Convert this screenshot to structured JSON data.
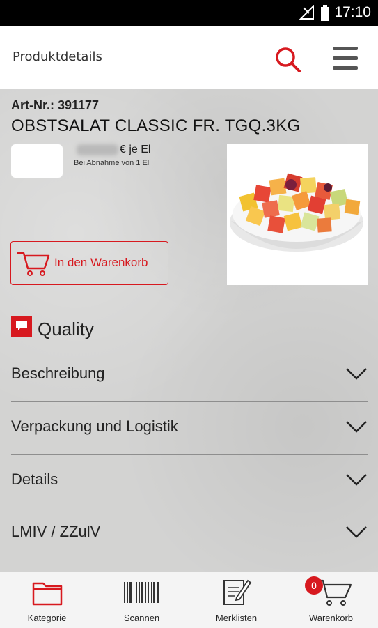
{
  "status_bar": {
    "time": "17:10"
  },
  "app_bar": {
    "title": "Produktdetails",
    "search_icon": "search-icon",
    "menu_icon": "hamburger-menu-icon"
  },
  "product": {
    "article_label": "Art-Nr.: 391177",
    "name": "OBSTSALAT CLASSIC FR. TGQ.3KG",
    "price_unit": "€ je El",
    "price_note": "Bei Abnahme von 1 El",
    "add_to_cart_label": "In den Warenkorb"
  },
  "quality": {
    "label": "Quality"
  },
  "sections": [
    {
      "label": "Beschreibung"
    },
    {
      "label": "Verpackung und Logistik"
    },
    {
      "label": "Details"
    },
    {
      "label": "LMIV / ZZulV"
    }
  ],
  "bottom_nav": {
    "items": [
      {
        "label": "Kategorie",
        "icon": "folder-icon"
      },
      {
        "label": "Scannen",
        "icon": "barcode-icon"
      },
      {
        "label": "Merklisten",
        "icon": "notepad-icon"
      },
      {
        "label": "Warenkorb",
        "icon": "cart-icon"
      }
    ],
    "cart_count": "0"
  },
  "colors": {
    "accent": "#d7191f",
    "background": "#d3d3d2",
    "appbar": "#ffffff"
  }
}
